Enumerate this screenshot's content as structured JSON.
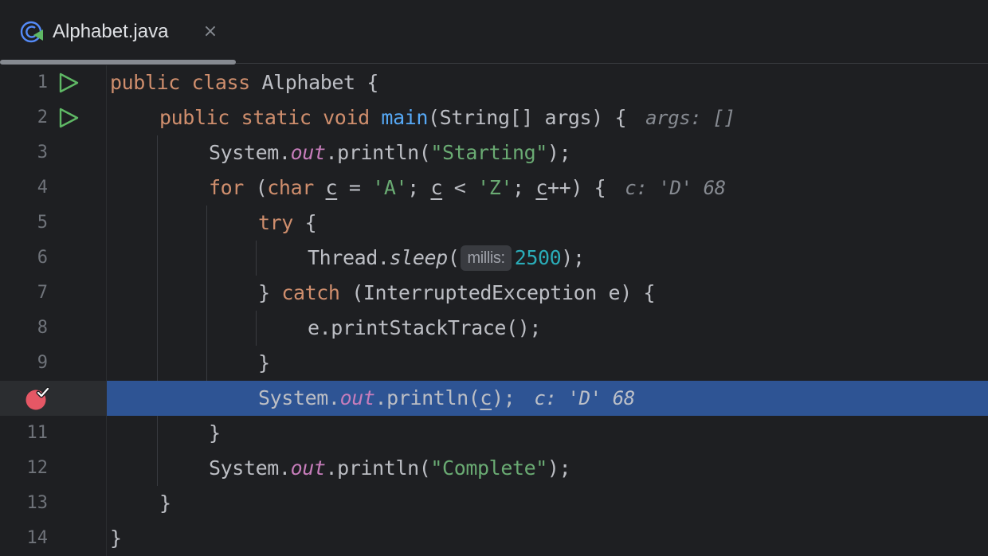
{
  "tab": {
    "label": "Alphabet.java",
    "close_glyph": "×",
    "icon": "java-class-icon"
  },
  "gutter": {
    "line_numbers": [
      "1",
      "2",
      "3",
      "4",
      "5",
      "6",
      "7",
      "8",
      "9",
      "",
      "11",
      "12",
      "13",
      "14"
    ],
    "run_icon": "run-gutter-icon",
    "breakpoint_icon": "breakpoint-hit-icon"
  },
  "code": {
    "l1": {
      "kw1": "public",
      "kw2": "class",
      "name": "Alphabet",
      "brace": "{"
    },
    "l2": {
      "kw1": "public",
      "kw2": "static",
      "kw3": "void",
      "fn": "main",
      "params": "(String[] args) {",
      "hint": "args: []"
    },
    "l3": {
      "cls": "System.",
      "fld": "out",
      "call": ".println(",
      "str": "\"Starting\"",
      "end": ");"
    },
    "l4": {
      "kw1": "for",
      "p1": " (",
      "kw2": "char",
      "sp": " ",
      "v1": "c",
      "p2": " = ",
      "s1": "'A'",
      "p3": "; ",
      "v2": "c",
      "p4": " < ",
      "s2": "'Z'",
      "p5": "; ",
      "v3": "c",
      "p6": "++) {",
      "hint": "c: 'D' 68"
    },
    "l5": {
      "kw": "try",
      "rest": " {"
    },
    "l6": {
      "cls": "Thread.",
      "stat": "sleep",
      "open": "(",
      "param_hint": "millis:",
      "num": "2500",
      "end": ");"
    },
    "l7": {
      "p1": "} ",
      "kw": "catch",
      "rest": " (InterruptedException e) {"
    },
    "l8": {
      "text": "e.printStackTrace();"
    },
    "l9": {
      "text": "}"
    },
    "l10": {
      "cls": "System.",
      "fld": "out",
      "call": ".println(",
      "v": "c",
      "end": ");",
      "hint": "c: 'D' 68"
    },
    "l11": {
      "text": "}"
    },
    "l12": {
      "cls": "System.",
      "fld": "out",
      "call": ".println(",
      "str": "\"Complete\"",
      "end": ");"
    },
    "l13": {
      "text": "}"
    },
    "l14": {
      "text": "}"
    }
  },
  "colors": {
    "background": "#1e1f22",
    "execution_line": "#2e5494",
    "keyword": "#cf8e6d",
    "function": "#56a8f5",
    "string": "#6aab73",
    "number": "#2aacb8",
    "field": "#c77dbb",
    "breakpoint": "#e55765"
  }
}
